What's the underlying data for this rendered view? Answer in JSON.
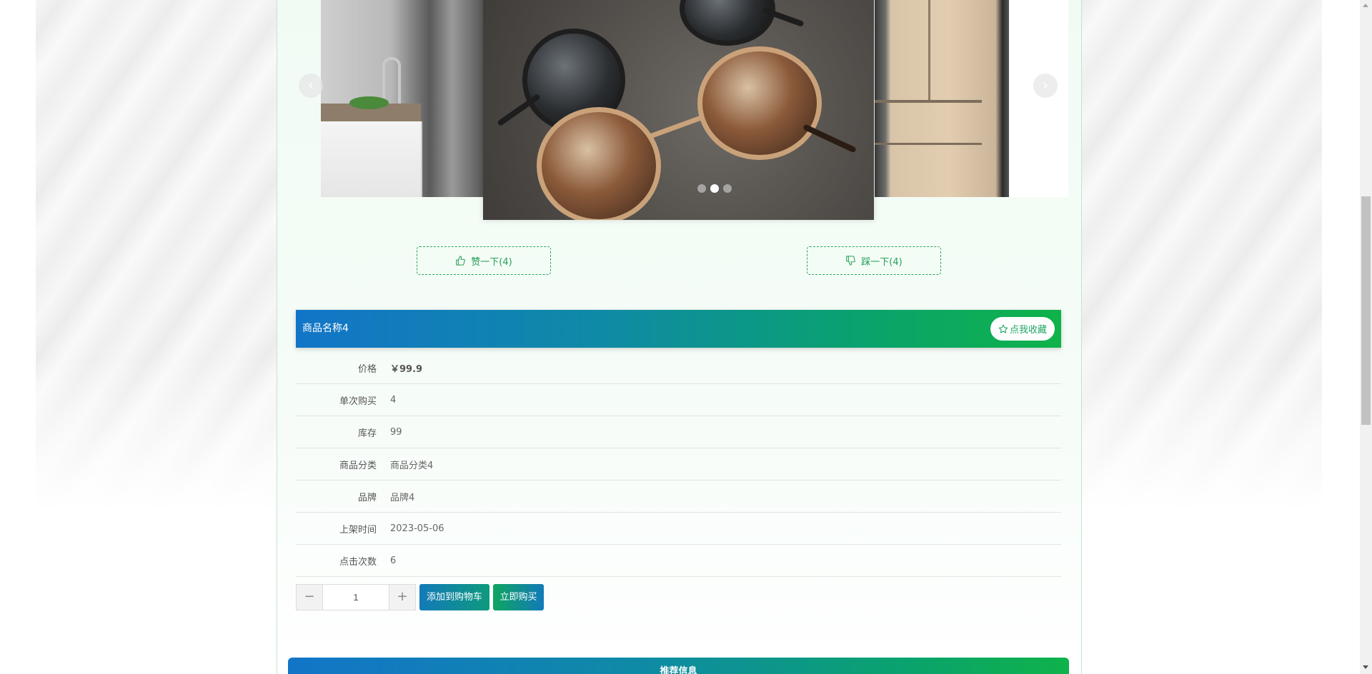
{
  "carousel": {
    "prev_arrow": "‹",
    "next_arrow": "›",
    "slide_count": 3,
    "active_index": 1
  },
  "votes": {
    "like_label": "赞一下(4)",
    "dislike_label": "踩一下(4)"
  },
  "product": {
    "name": "商品名称4",
    "favorite_label": "点我收藏",
    "rows": [
      {
        "label": "价格",
        "value": "￥99.9"
      },
      {
        "label": "单次购买",
        "value": "4"
      },
      {
        "label": "库存",
        "value": "99"
      },
      {
        "label": "商品分类",
        "value": "商品分类4"
      },
      {
        "label": "品牌",
        "value": "品牌4"
      },
      {
        "label": "上架时间",
        "value": "2023-05-06"
      },
      {
        "label": "点击次数",
        "value": "6"
      }
    ]
  },
  "purchase": {
    "decrement": "−",
    "increment": "+",
    "quantity": "1",
    "add_to_cart_label": "添加到购物车",
    "buy_now_label": "立即购买"
  },
  "recommend": {
    "title": "推荐信息"
  },
  "colors": {
    "accent_green": "#24a058",
    "header_gradient_start": "#1275c8",
    "header_gradient_end": "#0fb24a"
  }
}
